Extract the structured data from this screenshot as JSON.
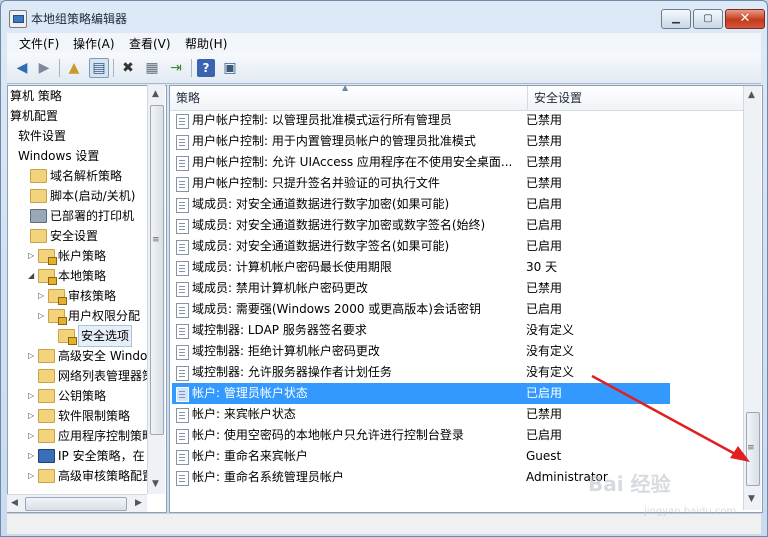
{
  "window": {
    "title": "本地组策略编辑器",
    "min": "▁",
    "max": "▢",
    "close": "✕"
  },
  "menu": [
    "文件(F)",
    "操作(A)",
    "查看(V)",
    "帮助(H)"
  ],
  "toolbar": {
    "icons": [
      "back-arrow-icon",
      "forward-arrow-icon",
      "up-folder-icon",
      "show-hide-tree-icon",
      "delete-icon",
      "properties-icon",
      "export-list-icon",
      "help-icon",
      "view-icon"
    ]
  },
  "tree": [
    {
      "label": "算机 策略",
      "icon": "",
      "twisty": ""
    },
    {
      "label": "算机配置",
      "icon": "",
      "twisty": ""
    },
    {
      "label": "软件设置",
      "icon": "",
      "twisty": ""
    },
    {
      "label": "Windows 设置",
      "icon": "",
      "twisty": ""
    },
    {
      "label": "域名解析策略",
      "icon": "folder",
      "twisty": ""
    },
    {
      "label": "脚本(启动/关机)",
      "icon": "folder",
      "twisty": ""
    },
    {
      "label": "已部署的打印机",
      "icon": "printer",
      "twisty": ""
    },
    {
      "label": "安全设置",
      "icon": "folder",
      "twisty": ""
    },
    {
      "label": "帐户策略",
      "icon": "lock",
      "twisty": "▷"
    },
    {
      "label": "本地策略",
      "icon": "lock",
      "twisty": "◢"
    },
    {
      "label": "审核策略",
      "icon": "lock",
      "twisty": "▷"
    },
    {
      "label": "用户权限分配",
      "icon": "lock",
      "twisty": "▷"
    },
    {
      "label": "安全选项",
      "icon": "lock",
      "twisty": ""
    },
    {
      "label": "高级安全 Windo",
      "icon": "folder",
      "twisty": "▷"
    },
    {
      "label": "网络列表管理器策",
      "icon": "folder",
      "twisty": ""
    },
    {
      "label": "公钥策略",
      "icon": "folder",
      "twisty": "▷"
    },
    {
      "label": "软件限制策略",
      "icon": "folder",
      "twisty": "▷"
    },
    {
      "label": "应用程序控制策略",
      "icon": "folder",
      "twisty": "▷"
    },
    {
      "label": "IP 安全策略，在",
      "icon": "shield",
      "twisty": "▷"
    },
    {
      "label": "高级审核策略配置",
      "icon": "folder",
      "twisty": "▷"
    }
  ],
  "list": {
    "columns": {
      "policy": "策略",
      "setting": "安全设置"
    },
    "rows": [
      {
        "policy": "用户帐户控制: 以管理员批准模式运行所有管理员",
        "setting": "已禁用"
      },
      {
        "policy": "用户帐户控制: 用于内置管理员帐户的管理员批准模式",
        "setting": "已禁用"
      },
      {
        "policy": "用户帐户控制: 允许 UIAccess 应用程序在不使用安全桌面...",
        "setting": "已禁用"
      },
      {
        "policy": "用户帐户控制: 只提升签名并验证的可执行文件",
        "setting": "已禁用"
      },
      {
        "policy": "域成员: 对安全通道数据进行数字加密(如果可能)",
        "setting": "已启用"
      },
      {
        "policy": "域成员: 对安全通道数据进行数字加密或数字签名(始终)",
        "setting": "已启用"
      },
      {
        "policy": "域成员: 对安全通道数据进行数字签名(如果可能)",
        "setting": "已启用"
      },
      {
        "policy": "域成员: 计算机帐户密码最长使用期限",
        "setting": "30 天"
      },
      {
        "policy": "域成员: 禁用计算机帐户密码更改",
        "setting": "已禁用"
      },
      {
        "policy": "域成员: 需要强(Windows 2000 或更高版本)会话密钥",
        "setting": "已启用"
      },
      {
        "policy": "域控制器: LDAP 服务器签名要求",
        "setting": "没有定义"
      },
      {
        "policy": "域控制器: 拒绝计算机帐户密码更改",
        "setting": "没有定义"
      },
      {
        "policy": "域控制器: 允许服务器操作者计划任务",
        "setting": "没有定义"
      },
      {
        "policy": "帐户: 管理员帐户状态",
        "setting": "已启用",
        "selected": true
      },
      {
        "policy": "帐户: 来宾帐户状态",
        "setting": "已禁用"
      },
      {
        "policy": "帐户: 使用空密码的本地帐户只允许进行控制台登录",
        "setting": "已启用"
      },
      {
        "policy": "帐户: 重命名来宾帐户",
        "setting": "Guest"
      },
      {
        "policy": "帐户: 重命名系统管理员帐户",
        "setting": "Administrator"
      }
    ]
  },
  "watermark": {
    "logo": "Bai 经验",
    "url": "jingyan.baidu.com"
  },
  "colors": {
    "selection": "#3399ff",
    "annotation_arrow": "#e02020"
  }
}
